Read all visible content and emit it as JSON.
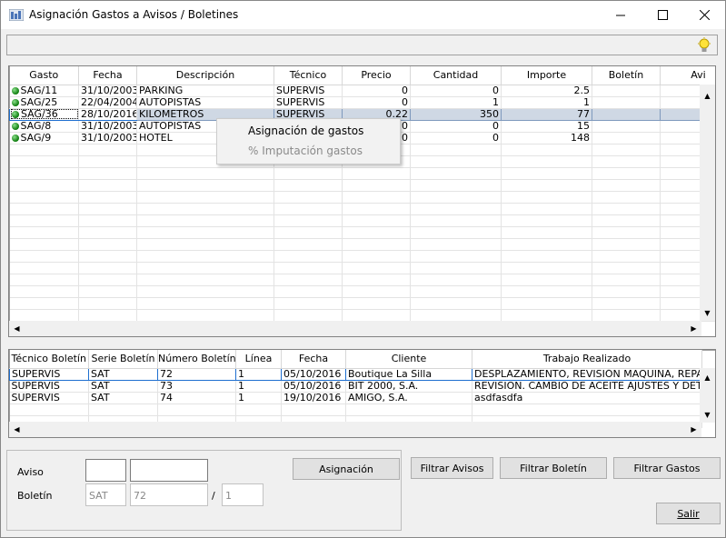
{
  "window": {
    "title": "Asignación Gastos a Avisos / Boletines",
    "minimize": "–",
    "maximize": "☐",
    "close": "✕"
  },
  "gastos": {
    "columns": [
      "Gasto",
      "Fecha",
      "Descripción",
      "Técnico",
      "Precio",
      "Cantidad",
      "Importe",
      "Boletín",
      "Avi"
    ],
    "rows": [
      {
        "gasto": "SAG/11",
        "fecha": "31/10/2003",
        "desc": "PARKING",
        "tecnico": "SUPERVIS",
        "precio": "0",
        "cantidad": "0",
        "importe": "2.5"
      },
      {
        "gasto": "SAG/25",
        "fecha": "22/04/2004",
        "desc": "AUTOPISTAS",
        "tecnico": "SUPERVIS",
        "precio": "0",
        "cantidad": "1",
        "importe": "1"
      },
      {
        "gasto": "SAG/36",
        "fecha": "28/10/2016",
        "desc": "KILOMETROS",
        "tecnico": "SUPERVIS",
        "precio": "0.22",
        "cantidad": "350",
        "importe": "77"
      },
      {
        "gasto": "SAG/8",
        "fecha": "31/10/2003",
        "desc": "AUTOPISTAS",
        "tecnico": "",
        "precio": "0",
        "cantidad": "0",
        "importe": "15"
      },
      {
        "gasto": "SAG/9",
        "fecha": "31/10/2003",
        "desc": "HOTEL",
        "tecnico": "",
        "precio": "0",
        "cantidad": "0",
        "importe": "148"
      }
    ]
  },
  "context_menu": {
    "items": [
      "Asignación de gastos",
      "% Imputación gastos"
    ]
  },
  "boletines": {
    "columns": [
      "Técnico Boletín",
      "Serie Boletín",
      "Número Boletín",
      "Línea",
      "Fecha",
      "Cliente",
      "Trabajo Realizado"
    ],
    "rows": [
      {
        "tecnico": "SUPERVIS",
        "serie": "SAT",
        "numero": "72",
        "linea": "1",
        "fecha": "05/10/2016",
        "cliente": "Boutique La Silla",
        "trabajo": "DESPLAZAMIENTO, REVISIÓN MAQUINA, REPAR"
      },
      {
        "tecnico": "SUPERVIS",
        "serie": "SAT",
        "numero": "73",
        "linea": "1",
        "fecha": "05/10/2016",
        "cliente": "BIT 2000, S.A.",
        "trabajo": "REVISION. CAMBIO DE ACEITE AJUSTES Y DETE"
      },
      {
        "tecnico": "SUPERVIS",
        "serie": "SAT",
        "numero": "74",
        "linea": "1",
        "fecha": "19/10/2016",
        "cliente": "AMIGO, S.A.",
        "trabajo": "asdfasdfa"
      }
    ]
  },
  "form": {
    "aviso_label": "Aviso",
    "boletin_label": "Boletín",
    "aviso_serie": "",
    "aviso_numero": "",
    "boletin_serie": "SAT",
    "boletin_numero": "72",
    "separator": "/",
    "boletin_linea": "1"
  },
  "buttons": {
    "asignacion": "Asignación",
    "filtrar_avisos": "Filtrar Avisos",
    "filtrar_boletin": "Filtrar Boletín",
    "filtrar_gastos": "Filtrar Gastos",
    "salir": "Salir"
  }
}
